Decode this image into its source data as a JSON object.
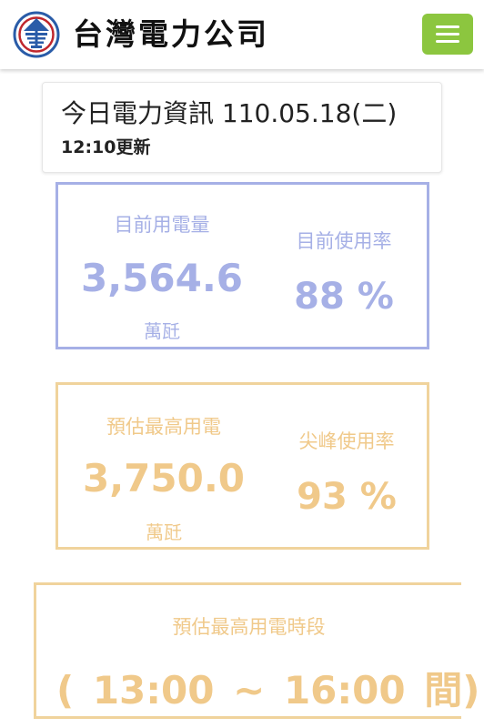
{
  "header": {
    "brand_name": "台灣電力公司",
    "logo_icon": "taipower-logo-icon",
    "menu_icon": "hamburger-menu-icon",
    "menu_color": "#8cc63f"
  },
  "info": {
    "title": "今日電力資訊 110.05.18(二)",
    "updated": "12:10更新"
  },
  "current": {
    "usage_label": "目前用電量",
    "usage_value": "3,564.6",
    "usage_unit": "萬瓩",
    "rate_label": "目前使用率",
    "rate_value": "88 %",
    "color": "#a6b0e6"
  },
  "forecast": {
    "peak_label": "預估最高用電",
    "peak_value": "3,750.0",
    "peak_unit": "萬瓩",
    "rate_label": "尖峰使用率",
    "rate_value": "93 %",
    "color": "#f0c98a"
  },
  "period": {
    "label": "預估最高用電時段",
    "value": "( 13:00 ~ 16:00 間)"
  }
}
